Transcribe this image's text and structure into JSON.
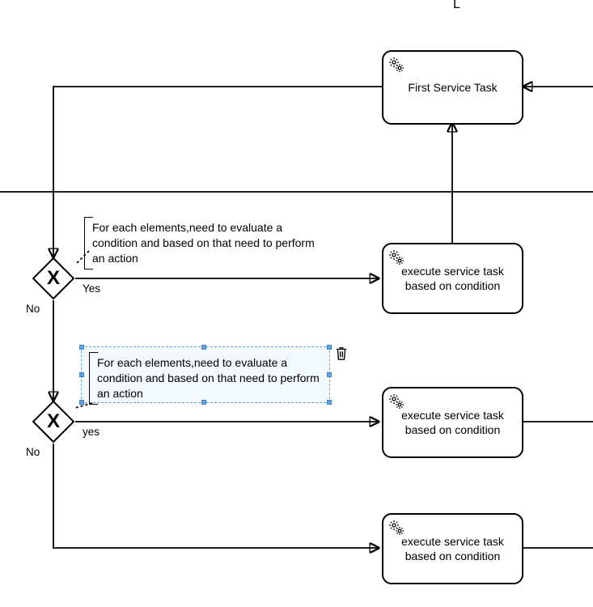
{
  "corner_marker": "L",
  "tasks": {
    "first_service": {
      "label": "First Service Task"
    },
    "exec1": {
      "label": "execute service task based on condition"
    },
    "exec2": {
      "label": "execute service task based on condition"
    },
    "exec3": {
      "label": "execute service task based on condition"
    }
  },
  "gateways": {
    "g1": {
      "no_label": "No",
      "yes_label": "Yes"
    },
    "g2": {
      "no_label": "No",
      "yes_label": "yes"
    }
  },
  "annotations": {
    "a1": "For each elements,need to evaluate a condition and based on that need to perform an action",
    "a2": "For each elements,need to evaluate a condition and based on that need to perform an action"
  },
  "icons": {
    "gear": "gear-icon",
    "trash": "trash-icon"
  }
}
